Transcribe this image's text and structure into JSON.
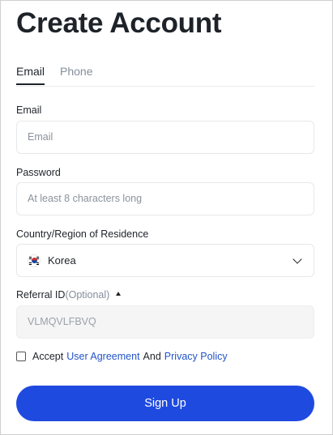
{
  "page": {
    "title": "Create Account"
  },
  "tabs": [
    {
      "label": "Email",
      "active": true
    },
    {
      "label": "Phone",
      "active": false
    }
  ],
  "form": {
    "email": {
      "label": "Email",
      "placeholder": "Email",
      "value": ""
    },
    "password": {
      "label": "Password",
      "placeholder": "At least 8 characters long",
      "value": ""
    },
    "country": {
      "label": "Country/Region of Residence",
      "selected": "Korea",
      "flag_icon": "korea-flag-icon"
    },
    "referral": {
      "label": "Referral ID",
      "optional_text": "(Optional)",
      "value": "VLMQVLFBVQ",
      "disabled": true
    }
  },
  "agreement": {
    "prefix": "Accept",
    "user_agreement": "User Agreement",
    "conjunction": "And",
    "privacy_policy": "Privacy Policy",
    "checked": false
  },
  "actions": {
    "signup_label": "Sign Up"
  },
  "colors": {
    "primary_button": "#1f4ae0",
    "link": "#2354c8",
    "text": "#1e2329",
    "muted": "#848e9c"
  }
}
